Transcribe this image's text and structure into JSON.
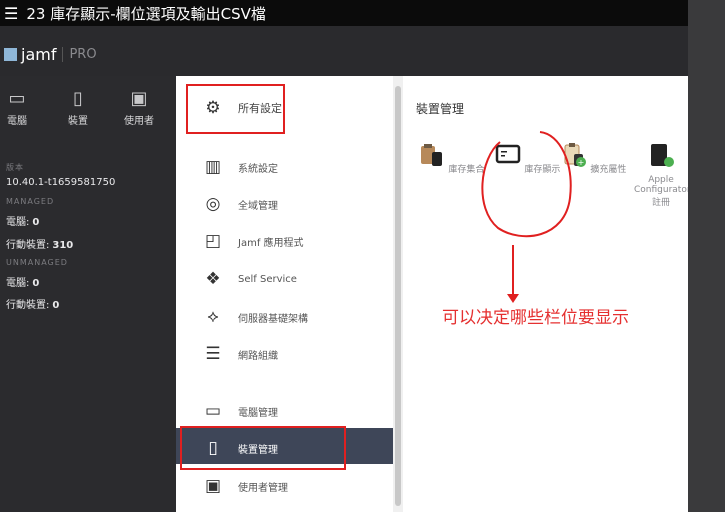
{
  "video_title": "23 庫存顯示-欄位選項及輸出CSV檔",
  "brand": {
    "name": "jamf",
    "edition": "PRO"
  },
  "top_tabs": [
    {
      "label": "電腦",
      "icon": "laptop-icon"
    },
    {
      "label": "裝置",
      "icon": "mobile-device-icon"
    },
    {
      "label": "使用者",
      "icon": "user-badge-icon"
    }
  ],
  "info": {
    "version_label": "版本",
    "version": "10.40.1-t1659581750",
    "managed_label": "MANAGED",
    "managed_computers_label": "電腦:",
    "managed_computers": "0",
    "managed_devices_label": "行動裝置:",
    "managed_devices": "310",
    "unmanaged_label": "UNMANAGED",
    "unmanaged_computers_label": "電腦:",
    "unmanaged_computers": "0",
    "unmanaged_devices_label": "行動裝置:",
    "unmanaged_devices": "0"
  },
  "settings_nav": [
    {
      "label": "所有設定",
      "icon": "gear-icon"
    },
    {
      "label": "系統設定",
      "icon": "system-settings-icon"
    },
    {
      "label": "全域管理",
      "icon": "globe-icon"
    },
    {
      "label": "Jamf 應用程式",
      "icon": "jamf-apps-icon"
    },
    {
      "label": "Self Service",
      "icon": "self-service-icon"
    },
    {
      "label": "伺服器基礎架構",
      "icon": "server-infrastructure-icon"
    },
    {
      "label": "網路組織",
      "icon": "network-icon"
    },
    {
      "label": "電腦管理",
      "icon": "laptop-icon"
    },
    {
      "label": "裝置管理",
      "icon": "mobile-device-icon"
    },
    {
      "label": "使用者管理",
      "icon": "user-badge-icon"
    }
  ],
  "content": {
    "title": "裝置管理",
    "tiles": [
      {
        "label": "庫存集合",
        "icon": "inventory-collection-icon"
      },
      {
        "label": "庫存顯示",
        "icon": "inventory-display-icon"
      },
      {
        "label": "擴充屬性",
        "icon": "extension-attributes-icon"
      },
      {
        "label": "Apple Configurator 註冊",
        "icon": "apple-configurator-icon"
      }
    ]
  },
  "annotation": "可以决定哪些栏位要显示",
  "colors": {
    "annotation_red": "#e02020",
    "active_nav": "#3e4658"
  }
}
